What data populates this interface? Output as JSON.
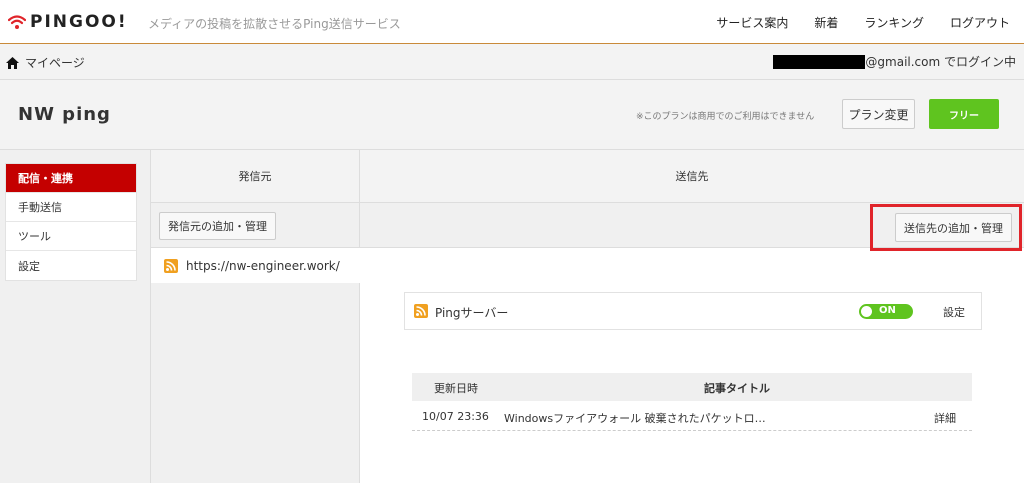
{
  "header": {
    "logo_text": "PINGOO!",
    "tagline": "メディアの投稿を拡散させるPing送信サービス",
    "nav": [
      "サービス案内",
      "新着",
      "ランキング",
      "ログアウト"
    ]
  },
  "breadcrumb": {
    "label": "マイページ",
    "login_suffix": "@gmail.com でログイン中"
  },
  "title_row": {
    "title": "NW ping",
    "plan_note": "※このプランは商用でのご利用はできません",
    "plan_change_label": "プラン変更",
    "plan_badge_label": "フリー"
  },
  "sidebar": {
    "items": [
      {
        "label": "配信・連携",
        "active": true
      },
      {
        "label": "手動送信",
        "active": false
      },
      {
        "label": "ツール",
        "active": false
      },
      {
        "label": "設定",
        "active": false
      }
    ]
  },
  "source": {
    "header": "発信元",
    "add_button": "発信元の追加・管理",
    "url": "https://nw-engineer.work/"
  },
  "destination": {
    "header": "送信先",
    "add_button": "送信先の追加・管理",
    "ping": {
      "label": "Pingサーバー",
      "toggle_label": "ON",
      "settings_label": "設定"
    },
    "table": {
      "columns": [
        "更新日時",
        "記事タイトル"
      ],
      "rows": [
        {
          "datetime": "10/07 23:36",
          "title": "Windowsファイアウォール 破棄されたパケットロ…",
          "action": "詳細"
        }
      ]
    }
  },
  "colors": {
    "accent_red": "#c40000",
    "highlight_red": "#e0242a",
    "green": "#5fc41f",
    "header_border": "#c98a3a"
  }
}
